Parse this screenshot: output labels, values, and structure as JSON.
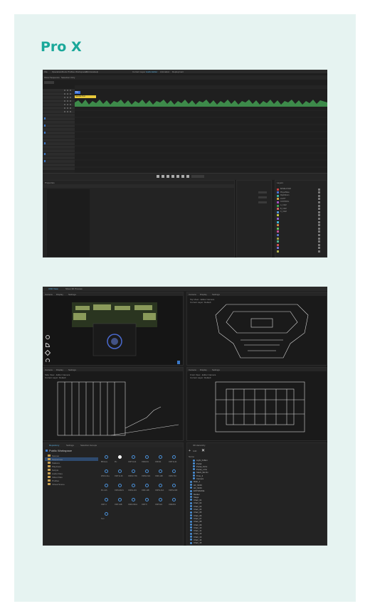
{
  "page": {
    "title": "Pro X"
  },
  "colors": {
    "accent": "#1aa89a",
    "card": "#e6f3f1",
    "editor_bg": "#1e1e1e",
    "waveform": "#3d8a4a",
    "clip_yellow": "#e8c93a"
  },
  "shot1": {
    "menu": [
      "File",
      "Operations",
      "Tools",
      "Profiles",
      "Workspaces",
      "Windows",
      "Help"
    ],
    "center_tabs": [
      "Current Layer",
      "Audio Editor",
      "Animation",
      "Deployment"
    ],
    "tabs": [
      "Show Sequence",
      "Selection Only"
    ],
    "clips": [
      "Key",
      "Sample Text"
    ],
    "track_rows": 24,
    "panel_header": "Properties",
    "layers_header": "Layers",
    "layer_items": [
      "BASELAYER",
      "PlayerBase",
      "RightRoom",
      "LIGHT",
      "CONTROL",
      "A_CAM",
      "B_CAM",
      "C_CAM"
    ],
    "layer_colors": [
      "#c84040",
      "#4a6fd0",
      "#3ab0a0",
      "#d0a040",
      "#a050c0",
      "#40a050",
      "#d06060",
      "#5090d0",
      "#c0c040",
      "#9060d0",
      "#40b0d0",
      "#d08040",
      "#60c060",
      "#c05090",
      "#5070c0",
      "#a0a040",
      "#50b090",
      "#d05050",
      "#7070d0",
      "#b0b050"
    ]
  },
  "shot2": {
    "top_tabs": [
      "USD View",
      "Show 3D Preview"
    ],
    "viewport_menus": [
      "Camera",
      "Display",
      "Settings"
    ],
    "viewport_labels": [
      "Top View - Editor Camera",
      "Current Layer: Default",
      "Side View - Editor Camera",
      "Front View - Editor Camera"
    ],
    "tool_icons": [
      "sun-icon",
      "curve-icon",
      "tools-icon",
      "gauge-icon"
    ],
    "bottom_tabs": [
      "Repository",
      "Settings",
      "Selection Groups"
    ],
    "tree_root": "Public Workspace",
    "tree_items": [
      "Scenes",
      "Sequences",
      "Stations",
      "PlayCues",
      "Scripts",
      "Audio Files",
      "Video Files",
      "Profiles",
      "Virtual Scene"
    ],
    "hierarchy_title": "3D Hierarchy",
    "hierarchy_add": "Add",
    "hierarchy_column": "Name",
    "hierarchy_items": [
      "Light_Fx/Em",
      "Portal",
      "Portal_S.Fix",
      "Portal_L.Fix",
      "Stack_9H.Fix",
      "Time_3",
      "Camera",
      "Main_1",
      "LR_SKIN",
      "LR_SKIN",
      "ENTRANCE",
      "Marker",
      "Stage",
      "Chair_01",
      "Chair_02",
      "Chair_03",
      "Chair_04",
      "Chair_05",
      "Chair_06",
      "Chair_07",
      "Chair_08",
      "Chair_09",
      "Chair_10",
      "Chair_11",
      "Chair_12",
      "Chair_13",
      "Chair_14",
      "Chair_15"
    ],
    "assets": [
      "BPicture",
      "Pic",
      "OWT11-01",
      "OWAC01",
      "OWC01",
      "OWT11-01",
      "WNK1-01a",
      "OWT11-06",
      "OWNO-T36",
      "OWN4-S01",
      "OWF-12B",
      "OWN-T10",
      "Pic-A1S",
      "OWN-REX1",
      "OWN1-201",
      "OWF-12B",
      "OWTE-01A",
      "OWTE-01B",
      "OWT-4",
      "OWT-02B",
      "OWD-FMA1",
      "OWT-5",
      "OWTG01",
      "OWEX01",
      "Text"
    ]
  }
}
